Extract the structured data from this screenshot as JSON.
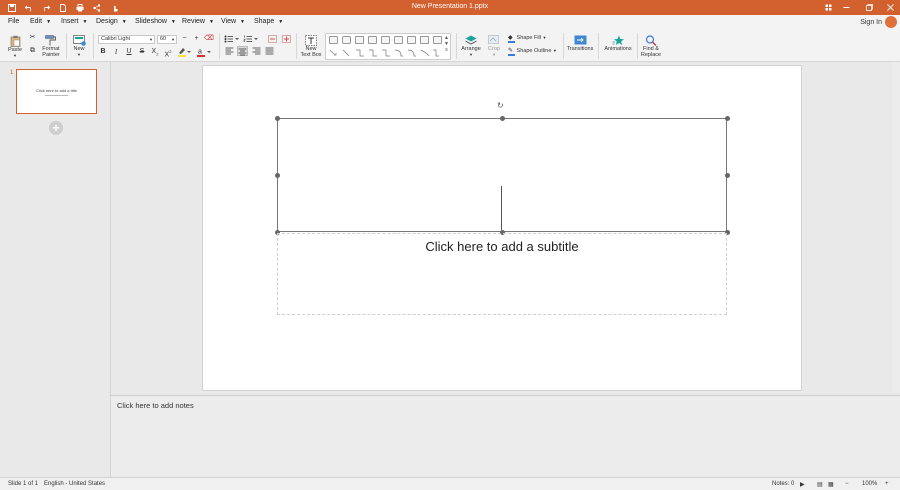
{
  "window": {
    "title": "New Presentation 1.pptx"
  },
  "menu": [
    {
      "label": "File",
      "has_caret": false
    },
    {
      "label": "Edit",
      "has_caret": true
    },
    {
      "label": "Insert",
      "has_caret": true
    },
    {
      "label": "Design",
      "has_caret": true
    },
    {
      "label": "Slideshow",
      "has_caret": true
    },
    {
      "label": "Review",
      "has_caret": true
    },
    {
      "label": "View",
      "has_caret": true
    },
    {
      "label": "Shape",
      "has_caret": true
    }
  ],
  "account": {
    "sign_in": "Sign In"
  },
  "ribbon": {
    "paste": "Paste",
    "format_painter": "Format Painter",
    "new": "New",
    "font_name": "Calibri Light",
    "font_size": "60",
    "new_text_box": "New Text Box",
    "shape_fill": "Shape Fill",
    "shape_outline": "Shape Outline",
    "arrange": "Arrange",
    "crop": "Crop",
    "transitions": "Transitions",
    "animations": "Animations",
    "find_replace": "Find & Replace"
  },
  "slides_panel": {
    "slide_number": "1",
    "thumb_title": "Click here to add a title"
  },
  "slide": {
    "subtitle_placeholder": "Click here to add a subtitle"
  },
  "notes": {
    "placeholder": "Click here to add notes"
  },
  "status": {
    "slide_info": "Slide 1 of 1",
    "language": "English - United States",
    "notes": "Notes: 0",
    "zoom": "100%"
  },
  "colors": {
    "accent": "#d3602f",
    "titlebar": "#d3602f"
  }
}
